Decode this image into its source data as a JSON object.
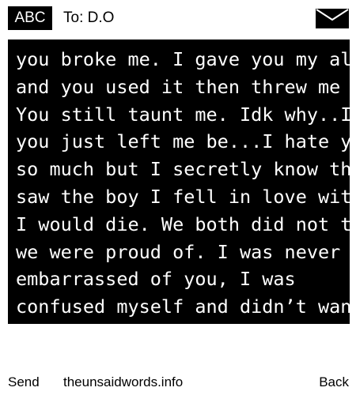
{
  "header": {
    "badge_label": "ABC",
    "recipient_label": "To: D.O",
    "compose_icon": "envelope-icon"
  },
  "message": {
    "lines": [
      "you broke me. I gave you my all",
      "and you used it then threw me out.",
      "You still taunt me. Idk why..I wish",
      "you just left me be...I hate you so",
      "so much but I secretly know that If",
      "saw the boy I fell in love with again",
      "I would die. We both did not things",
      "we were proud of. I was never",
      "embarrassed of you, I was",
      "confused myself and didn’t wanna"
    ]
  },
  "footer": {
    "send_label": "Send",
    "site_label": "theunsaidwords.info",
    "back_label": "Back"
  },
  "colors": {
    "background": "#ffffff",
    "message_background": "#000000",
    "message_text": "#ffffff",
    "text": "#000000"
  }
}
